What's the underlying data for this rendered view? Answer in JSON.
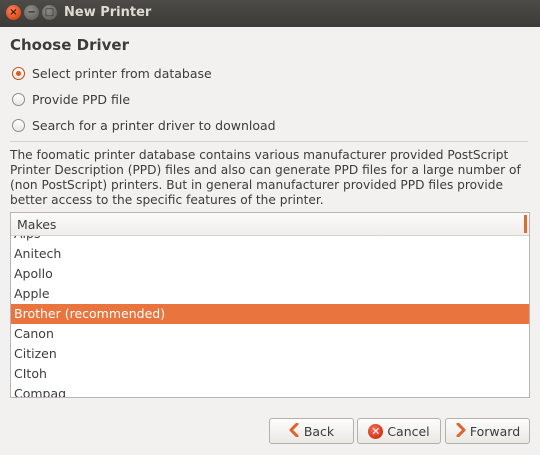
{
  "window": {
    "title": "New Printer",
    "controls": {
      "close": "×",
      "minimize": "−",
      "maximize": "□"
    }
  },
  "heading": "Choose Driver",
  "options": [
    {
      "label": "Select printer from database",
      "checked": true
    },
    {
      "label": "Provide PPD file",
      "checked": false
    },
    {
      "label": "Search for a printer driver to download",
      "checked": false
    }
  ],
  "description": "The foomatic printer database contains various manufacturer provided PostScript Printer Description (PPD) files and also can generate PPD files for a large number of (non PostScript) printers. But in general manufacturer provided PPD files provide better access to the specific features of the printer.",
  "makes": {
    "header": "Makes",
    "items": [
      "Alps",
      "Anitech",
      "Apollo",
      "Apple",
      "Brother (recommended)",
      "Canon",
      "Citizen",
      "CItoh",
      "Compaq"
    ],
    "selected": "Brother (recommended)"
  },
  "buttons": {
    "back": "Back",
    "cancel": "Cancel",
    "forward": "Forward"
  },
  "colors": {
    "accent": "#e9743d",
    "titlebar": "#3c3b37"
  }
}
